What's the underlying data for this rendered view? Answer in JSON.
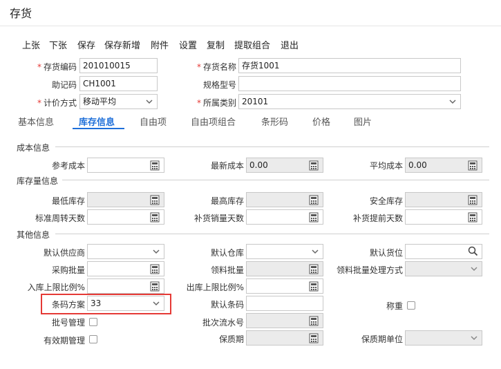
{
  "window": {
    "title": "存货"
  },
  "toolbar": [
    "上张",
    "下张",
    "保存",
    "保存新增",
    "附件",
    "设置",
    "复制",
    "提取组合",
    "退出"
  ],
  "header": {
    "code_label": "存货编码",
    "code_value": "201010015",
    "name_label": "存货名称",
    "name_value": "存货1001",
    "mnemonic_label": "助记码",
    "mnemonic_value": "CH1001",
    "spec_label": "规格型号",
    "spec_value": "",
    "pricing_label": "计价方式",
    "pricing_value": "移动平均",
    "category_label": "所属类别",
    "category_value": "20101",
    "required_mark": "*"
  },
  "tabs": [
    "基本信息",
    "库存信息",
    "自由项",
    "自由项组合",
    "条形码",
    "价格",
    "图片"
  ],
  "active_tab": "库存信息",
  "sections": {
    "cost": "成本信息",
    "stock": "库存量信息",
    "other": "其他信息"
  },
  "fields": {
    "ref_cost": {
      "label": "参考成本",
      "value": ""
    },
    "latest_cost": {
      "label": "最新成本",
      "value": "0.00"
    },
    "avg_cost": {
      "label": "平均成本",
      "value": "0.00"
    },
    "min_stock": {
      "label": "最低库存",
      "value": ""
    },
    "max_stock": {
      "label": "最高库存",
      "value": ""
    },
    "safe_stock": {
      "label": "安全库存",
      "value": ""
    },
    "turnover_days": {
      "label": "标准周转天数",
      "value": ""
    },
    "replenish_days": {
      "label": "补货销量天数",
      "value": ""
    },
    "lead_days": {
      "label": "补货提前天数",
      "value": ""
    },
    "default_supplier": {
      "label": "默认供应商",
      "value": ""
    },
    "default_warehouse": {
      "label": "默认仓库",
      "value": ""
    },
    "default_location": {
      "label": "默认货位",
      "value": ""
    },
    "purchase_batch": {
      "label": "采购批量",
      "value": ""
    },
    "material_batch": {
      "label": "领料批量",
      "value": ""
    },
    "material_batch_mode": {
      "label": "领料批量处理方式",
      "value": ""
    },
    "in_limit": {
      "label": "入库上限比例%",
      "value": ""
    },
    "out_limit": {
      "label": "出库上限比例%",
      "value": ""
    },
    "barcode_scheme": {
      "label": "条码方案",
      "value": "33"
    },
    "default_barcode": {
      "label": "默认条码",
      "value": ""
    },
    "weighing": {
      "label": "称重",
      "checked": false
    },
    "batch_mgmt": {
      "label": "批号管理",
      "checked": false
    },
    "batch_serial": {
      "label": "批次流水号",
      "value": ""
    },
    "expiry_mgmt": {
      "label": "有效期管理",
      "checked": false
    },
    "shelf_life": {
      "label": "保质期",
      "value": ""
    },
    "shelf_life_unit": {
      "label": "保质期单位",
      "value": ""
    }
  },
  "colors": {
    "accent": "#1e6fd9",
    "required": "#e53935",
    "highlight": "#e53935",
    "disabled": "#ebebeb"
  }
}
